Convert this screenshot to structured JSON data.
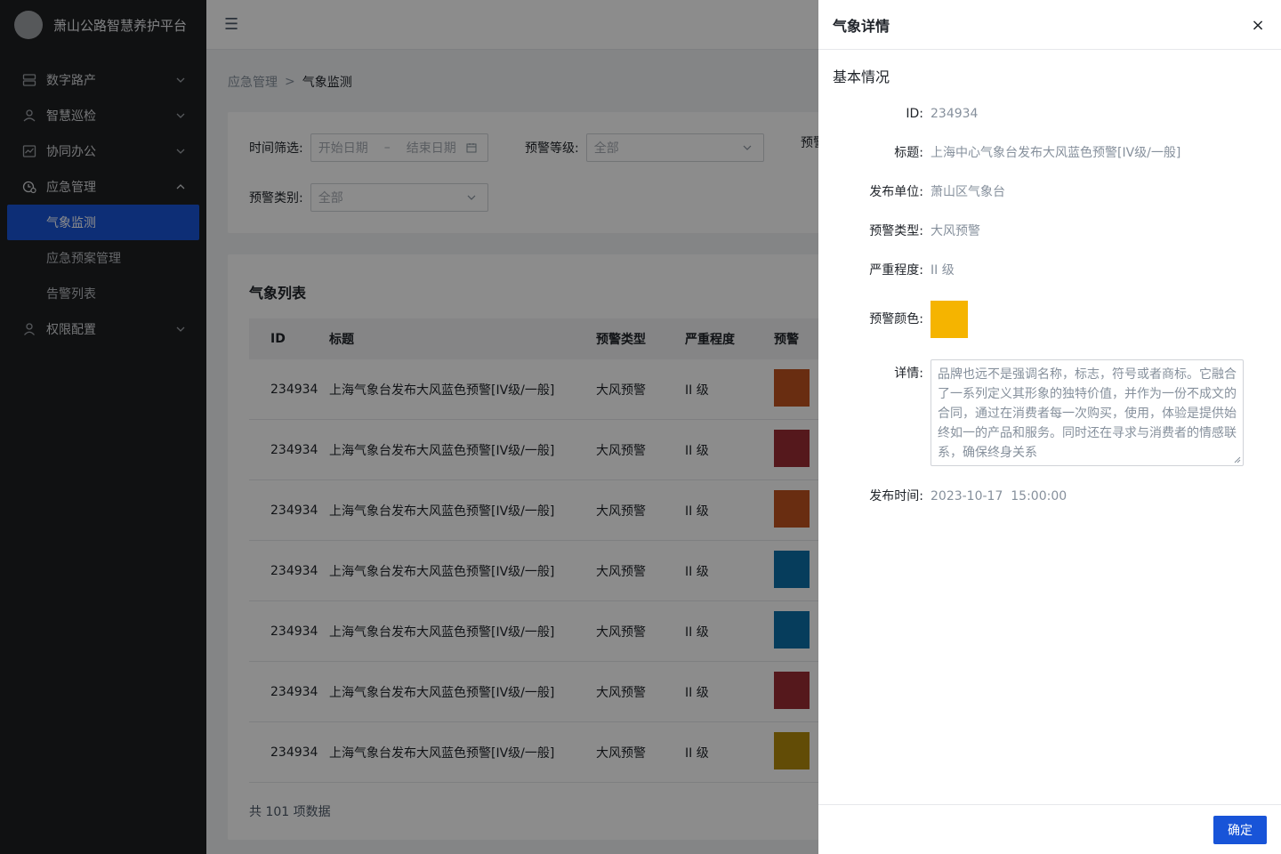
{
  "app": {
    "title": "萧山公路智慧养护平台"
  },
  "sidebar": {
    "items": [
      {
        "label": "数字路产",
        "icon": "server-icon"
      },
      {
        "label": "智慧巡检",
        "icon": "location-person-icon"
      },
      {
        "label": "协同办公",
        "icon": "chart-line-icon"
      },
      {
        "label": "应急管理",
        "icon": "alert-clock-icon"
      },
      {
        "label": "权限配置",
        "icon": "user-icon"
      }
    ],
    "submenu": [
      {
        "label": "气象监测"
      },
      {
        "label": "应急预案管理"
      },
      {
        "label": "告警列表"
      }
    ]
  },
  "breadcrumb": {
    "parent": "应急管理",
    "separator": ">",
    "current": "气象监测"
  },
  "filters": {
    "time_label": "时间筛选:",
    "start_placeholder": "开始日期",
    "range_sep": "–",
    "end_placeholder": "结束日期",
    "level_label": "预警等级:",
    "level_value": "全部",
    "third_label_partial": "预警",
    "category_label": "预警类别:",
    "category_value": "全部"
  },
  "table": {
    "title": "气象列表",
    "headers": {
      "id": "ID",
      "title": "标题",
      "type": "预警类型",
      "level": "严重程度",
      "color": "预警"
    },
    "rows": [
      {
        "id": "234934",
        "title": "上海气象台发布大风蓝色预警[IV级/一般]",
        "type": "大风预警",
        "level": "II 级",
        "color": "#c0531f"
      },
      {
        "id": "234934",
        "title": "上海气象台发布大风蓝色预警[IV级/一般]",
        "type": "大风预警",
        "level": "II 级",
        "color": "#9b2c33"
      },
      {
        "id": "234934",
        "title": "上海气象台发布大风蓝色预警[IV级/一般]",
        "type": "大风预警",
        "level": "II 级",
        "color": "#c0531f"
      },
      {
        "id": "234934",
        "title": "上海气象台发布大风蓝色预警[IV级/一般]",
        "type": "大风预警",
        "level": "II 级",
        "color": "#0b6fa8"
      },
      {
        "id": "234934",
        "title": "上海气象台发布大风蓝色预警[IV级/一般]",
        "type": "大风预警",
        "level": "II 级",
        "color": "#0b6fa8"
      },
      {
        "id": "234934",
        "title": "上海气象台发布大风蓝色预警[IV级/一般]",
        "type": "大风预警",
        "level": "II 级",
        "color": "#9b2c33"
      },
      {
        "id": "234934",
        "title": "上海气象台发布大风蓝色预警[IV级/一般]",
        "type": "大风预警",
        "level": "II 级",
        "color": "#b38a0c"
      }
    ],
    "total": "共 101 项数据"
  },
  "drawer": {
    "title": "气象详情",
    "section": "基本情况",
    "fields": {
      "id_label": "ID:",
      "id_value": "234934",
      "title_label": "标题:",
      "title_value": "上海中心气象台发布大风蓝色预警[IV级/一般]",
      "unit_label": "发布单位:",
      "unit_value": "萧山区气象台",
      "type_label": "预警类型:",
      "type_value": "大风预警",
      "level_label": "严重程度:",
      "level_value": "II 级",
      "color_label": "预警颜色:",
      "color_value": "#f5b400",
      "detail_label": "详情:",
      "detail_value": "品牌也远不是强调名称，标志，符号或者商标。它融合了一系列定义其形象的独特价值，并作为一份不成文的合同，通过在消费者每一次购买，使用，体验是提供始终如一的产品和服务。同时还在寻求与消费者的情感联系，确保终身关系",
      "time_label": "发布时间:",
      "time_value": "2023-10-17  15:00:00"
    },
    "ok_label": "确定"
  },
  "colors": {
    "accent": "#1854d8",
    "sidebar_bg": "#1e1f21"
  }
}
